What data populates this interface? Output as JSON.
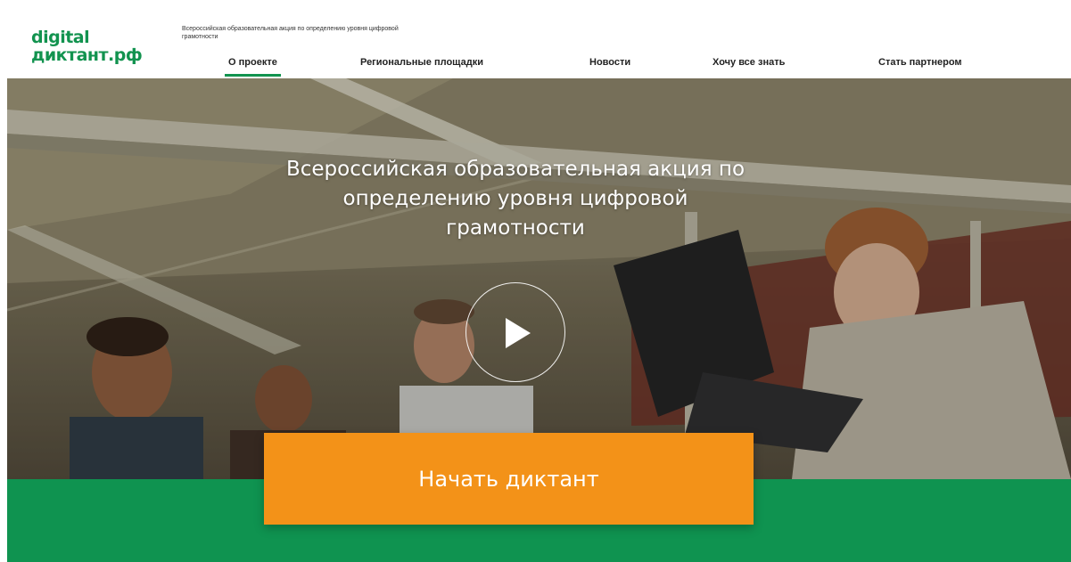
{
  "header": {
    "logo_line1": "digital",
    "logo_line2": "диктант.рф",
    "tagline": "Всероссийская образовательная акция по определению уровня цифровой грамотности"
  },
  "nav": {
    "items": [
      {
        "label": "О проекте",
        "active": true
      },
      {
        "label": "Региональные площадки",
        "active": false
      },
      {
        "label": "Новости",
        "active": false
      },
      {
        "label": "Хочу все знать",
        "active": false
      },
      {
        "label": "Стать партнером",
        "active": false
      }
    ]
  },
  "hero": {
    "title": "Всероссийская образовательная акция по определению уровня цифровой грамотности",
    "play_icon": "play-icon"
  },
  "cta": {
    "label": "Начать диктант"
  },
  "colors": {
    "brand_green": "#0f9350",
    "cta_orange": "#f39218",
    "text_dark": "#222222"
  }
}
